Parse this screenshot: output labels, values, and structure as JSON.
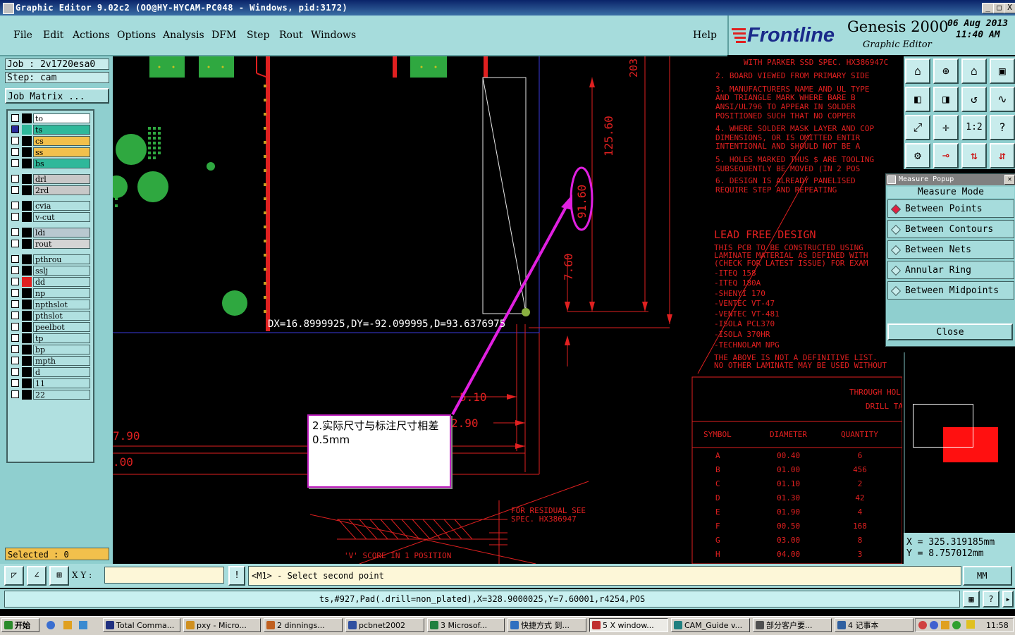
{
  "window": {
    "title": "Graphic Editor 9.02c2 (OO@HY-HYCAM-PC048 - Windows, pid:3172)",
    "min": "_",
    "max": "□",
    "close": "X"
  },
  "menu": [
    "File",
    "Edit",
    "Actions",
    "Options",
    "Analysis",
    "DFM",
    "Step",
    "Rout",
    "Windows"
  ],
  "help": "Help",
  "brand": {
    "logo": "Frontline",
    "product": "Genesis 2000",
    "subtitle": "Graphic Editor",
    "date": "06 Aug 2013",
    "time": "11:40 AM"
  },
  "job": {
    "job": "Job  : 2v1720esa0",
    "step": "Step: cam",
    "matrix": "Job Matrix ..."
  },
  "layers": [
    {
      "name": "to",
      "color": "#ffffff",
      "sw": "#000000"
    },
    {
      "name": "ts",
      "color": "#2fb89a",
      "sw": "#2fb89a",
      "checked": true
    },
    {
      "name": "cs",
      "color": "#f2c04c",
      "sw": "#000000"
    },
    {
      "name": "ss",
      "color": "#f2c04c",
      "sw": "#000000"
    },
    {
      "name": "bs",
      "color": "#2fb89a",
      "sw": "#000000"
    },
    {
      "name": "drl",
      "color": "#c8c8c8",
      "sw": "#000000"
    },
    {
      "name": "2rd",
      "color": "#c8c8c8",
      "sw": "#000000"
    },
    {
      "name": "cvia",
      "color": "#b0e0e0",
      "sw": "#000000"
    },
    {
      "name": "v-cut",
      "color": "#b0e0e0",
      "sw": "#000000"
    },
    {
      "name": "ldi",
      "color": "#b8c8d0",
      "sw": "#000000"
    },
    {
      "name": "rout",
      "color": "#d4d4d4",
      "sw": "#000000"
    },
    {
      "name": "pthrou",
      "color": "#b0e0e0",
      "sw": "#000000"
    },
    {
      "name": "sslj",
      "color": "#b0e0e0",
      "sw": "#000000"
    },
    {
      "name": "dd",
      "color": "#b0e0e0",
      "sw": "#e02020"
    },
    {
      "name": "np",
      "color": "#b0e0e0",
      "sw": "#000000"
    },
    {
      "name": "npthslot",
      "color": "#b0e0e0",
      "sw": "#000000"
    },
    {
      "name": "pthslot",
      "color": "#b0e0e0",
      "sw": "#000000"
    },
    {
      "name": "peelbot",
      "color": "#b0e0e0",
      "sw": "#000000"
    },
    {
      "name": "tp",
      "color": "#b0e0e0",
      "sw": "#000000"
    },
    {
      "name": "bp",
      "color": "#b0e0e0",
      "sw": "#000000"
    },
    {
      "name": "mpth",
      "color": "#b0e0e0",
      "sw": "#000000"
    },
    {
      "name": "d",
      "color": "#b0e0e0",
      "sw": "#000000"
    },
    {
      "name": "11",
      "color": "#b0e0e0",
      "sw": "#000000"
    },
    {
      "name": "22",
      "color": "#b0e0e0",
      "sw": "#000000"
    }
  ],
  "selected": "Selected : 0",
  "canvas": {
    "measure_readout": "DX=16.8999925,DY=-92.099995,D=93.6376975",
    "annotation": "2.实际尺寸与标注尺寸相差0.5mm",
    "dims": [
      "125.60",
      "91.60",
      "7.60",
      "203",
      "5.10",
      "2.90",
      "7.90",
      ".00"
    ],
    "notes": [
      "WITH PARKER SSD SPEC. HX386947C",
      "2.  BOARD VIEWED FROM PRIMARY SIDE",
      "3.  MANUFACTURERS NAME AND UL TYPE",
      "    AND TRIANGLE  MARK WHERE BARE B",
      "    ANSI/UL796 TO APPEAR IN SOLDER",
      "    POSITIONED SUCH THAT NO COPPER",
      "4.  WHERE SOLDER MASK LAYER AND COP",
      "    DIMENSIONS, OR IS OMITTED ENTIR",
      "    INTENTIONAL AND SHOULD NOT BE A",
      "5.  HOLES MARKED THUS $ ARE TOOLING",
      "    SUBSEQUENTLY BE MOVED (IN 2 POS",
      "6.  DESIGN IS ALREADY PANELISED",
      "    REQUIRE STEP AND REPEATING"
    ],
    "lead_free_title": "LEAD FREE DESIGN",
    "lead_free": [
      "THIS PCB TO BE CONSTRUCTED USING",
      "LAMINATE MATERIAL AS DEFINED WITH",
      "(CHECK FOR LATEST ISSUE) FOR EXAM",
      "-ITEQ 158",
      "-ITEQ 180A",
      "-SHENYI 170",
      "-VENTEC VT-47",
      "-VENTEC VT-481",
      "-ISOLA PCL370",
      "-ISOLA 370HR",
      "-TECHNOLAM NPG",
      "THE ABOVE IS NOT A DEFINITIVE LIST.",
      "NO OTHER LAMINATE MAY BE USED WITHOUT"
    ],
    "drill_title_1": "THROUGH HOL",
    "drill_title_2": "DRILL TABL",
    "drill_headers": [
      "SYMBOL",
      "DIAMETER",
      "QUANTITY"
    ],
    "drill_rows": [
      [
        "A",
        "00.40",
        "6"
      ],
      [
        "B",
        "01.00",
        "456"
      ],
      [
        "C",
        "01.10",
        "2"
      ],
      [
        "D",
        "01.30",
        "42"
      ],
      [
        "E",
        "01.90",
        "4"
      ],
      [
        "F",
        "00.50",
        "168"
      ],
      [
        "G",
        "03.00",
        "8"
      ],
      [
        "H",
        "04.00",
        "3"
      ]
    ],
    "residual_1": "FOR RESIDUAL SEE",
    "residual_2": "SPEC. HX386947",
    "vscore": "'V' SCORE IN 1 POSITION"
  },
  "measure_popup": {
    "title": "Measure Popup",
    "mode": "Measure Mode",
    "options": [
      "Between Points",
      "Between Contours",
      "Between Nets",
      "Annular Ring",
      "Between Midpoints"
    ],
    "selected": 0,
    "close": "Close"
  },
  "coords": {
    "x": "X  =  325.319185mm",
    "y": "Y  =  8.757012mm"
  },
  "cmd": {
    "xy_label": "X Y :",
    "xy_value": "",
    "prompt": "<M1> - Select second point",
    "units": "MM"
  },
  "status": "ts,#927,Pad(.drill=non_plated),X=328.9000025,Y=7.60001,r4254,POS",
  "taskbar": {
    "start": "开始",
    "tasks": [
      "Total Comma...",
      "pxy - Micro...",
      "2 dinnings...",
      "pcbnet2002",
      "3 Microsof...",
      "快捷方式 到...",
      "5 X window...",
      "CAM_Guide v...",
      "部分客户要...",
      "4 记事本"
    ],
    "clock": "11:58"
  }
}
